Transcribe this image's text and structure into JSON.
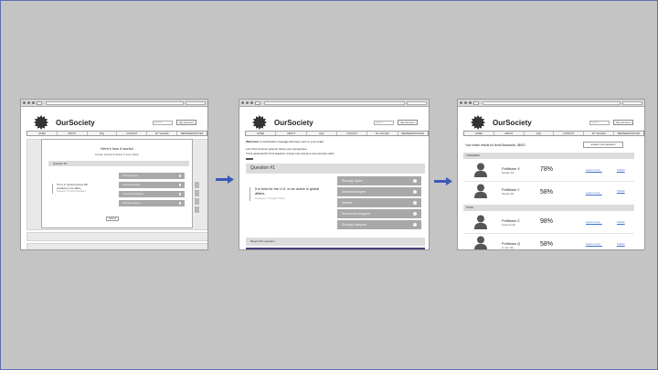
{
  "common": {
    "brand": "OurSociety",
    "search_placeholder": "Search",
    "account_label": "My Account",
    "nav": [
      "HOME",
      "ABOUT",
      "FAQ",
      "CONTACT",
      "MY VALUES",
      "REPRESENTATIVES"
    ]
  },
  "screen1": {
    "modal_title": "Here's how it works!",
    "modal_subtitle": "Answer questions below in your values",
    "question_label": "Question #1",
    "question_text": "The U.S. should continue fifth presidency in its affairs.",
    "question_tag": "Category: Foreign Relations",
    "options": [
      "Strongly agree",
      "Somewhat agree",
      "Somewhat disagree",
      "Strongly disagree"
    ],
    "submit": "Submit"
  },
  "screen2": {
    "welcome_bold": "Welcome!",
    "welcome_rest": " A confirmation message has been sent to your email.",
    "common_ground": "Let's find common ground; share your perspective.",
    "answered": "You've answered 0% of the questions. Answer more and get a more accurate match.",
    "question_label": "Question #1",
    "question_text": "It is best for the U.S. to be active in global affairs.",
    "question_tag": "Category: Foreign Policy",
    "options": [
      "Strongly agree",
      "Somewhat agree",
      "Neutral",
      "Somewhat disagree",
      "Strongly disagree"
    ],
    "report": "Report this question"
  },
  "screen3": {
    "results_label": "Your match results for North Brunswick, 08902",
    "new_questions": "answer more questions",
    "sections": [
      "CONGRESS",
      "STATE"
    ],
    "politicians": [
      {
        "name": "Politician X",
        "role": "Senator (D)",
        "match": "78%"
      },
      {
        "name": "Politician Y",
        "role": "Senator (D)",
        "match": "58%"
      },
      {
        "name": "Politician Z",
        "role": "Governor (D)",
        "match": "98%"
      },
      {
        "name": "Politician Q",
        "role": "Lt. Gov (R)",
        "match": "58%"
      }
    ],
    "learn_more": "Learn more...",
    "follow": "Follow"
  },
  "colors": {
    "background": "#c4c4c4",
    "arrow": "#3b58b8",
    "option_fill": "#a8a8a8",
    "link": "#3c6fd0",
    "accent_bar": "#4b3d7c"
  }
}
